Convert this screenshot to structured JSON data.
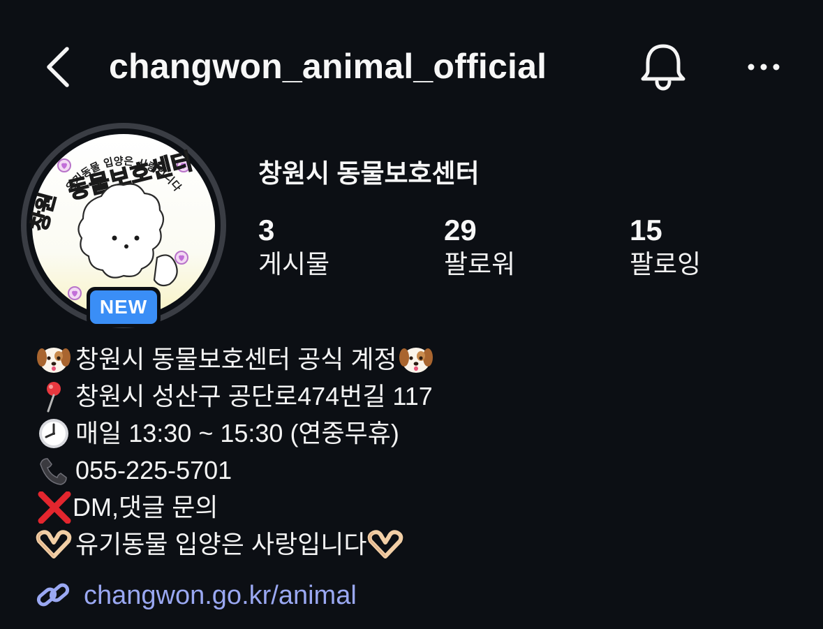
{
  "header": {
    "username": "changwon_animal_official",
    "back_icon": "chevron-left-icon",
    "bell_icon": "bell-icon",
    "more_icon": "more-horizontal-icon"
  },
  "avatar": {
    "top_text": "유기동물 입양은 사랑입니다",
    "brand_prefix": "창원",
    "brand_main": "동물보호센터",
    "badge": "NEW",
    "ring_color": "#3a3d44",
    "badge_color": "#3a8ef6"
  },
  "profile": {
    "display_name": "창원시 동물보호센터",
    "stats": [
      {
        "count": "3",
        "label": "게시물"
      },
      {
        "count": "29",
        "label": "팔로워"
      },
      {
        "count": "15",
        "label": "팔로잉"
      }
    ]
  },
  "bio": {
    "lines": [
      {
        "icon": "dog-face-icon",
        "text": "창원시 동물보호센터 공식 계정",
        "trail_icon": "dog-face-icon"
      },
      {
        "icon": "pin-icon",
        "text": "창원시 성산구 공단로474번길 117"
      },
      {
        "icon": "clock-icon",
        "text": "매일 13:30 ~ 15:30 (연중무휴)"
      },
      {
        "icon": "phone-icon",
        "text": "055-225-5701"
      },
      {
        "icon": "cross-mark-icon",
        "text": "DM,댓글 문의"
      },
      {
        "icon": "heart-hands-icon",
        "text": "유기동물 입양은 사랑입니다",
        "trail_icon": "heart-hands-icon"
      }
    ]
  },
  "link": {
    "icon": "link-icon",
    "text": "changwon.go.kr/animal",
    "color": "#9aa8f2"
  }
}
